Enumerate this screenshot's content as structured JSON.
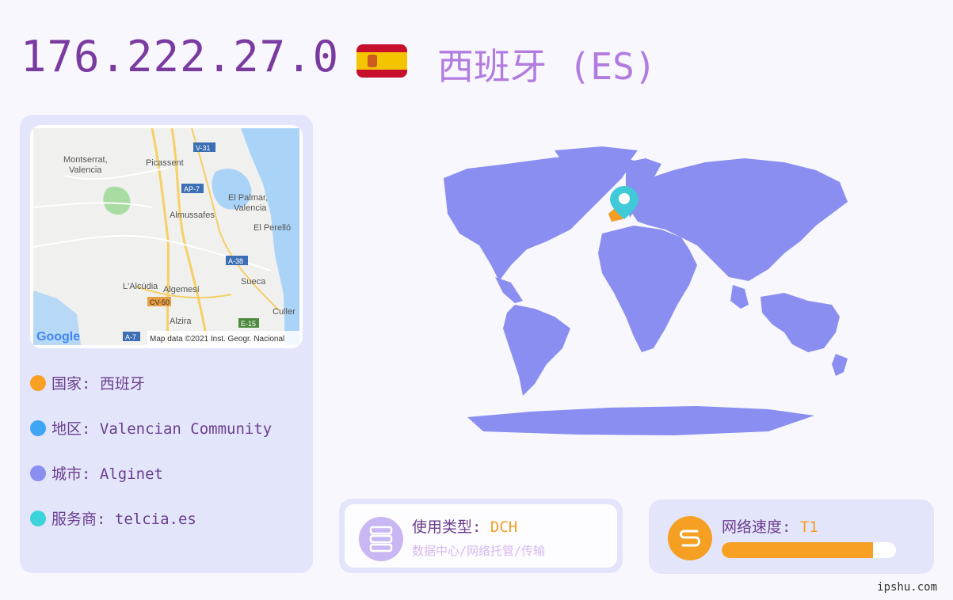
{
  "header": {
    "ip": "176.222.27.0",
    "country_title": "西班牙 (ES)"
  },
  "mini_map": {
    "labels": {
      "montserrat": "Montserrat,",
      "montserrat2": "Valencia",
      "picassent": "Picassent",
      "v31": "V-31",
      "ap7": "AP-7",
      "palmar": "El Palmar,",
      "palmar2": "Valencia",
      "almussafes": "Almussafes",
      "perello": "El Perelló",
      "a38": "A-38",
      "alcudia": "L'Alcúdia",
      "algemesi": "Algemesí",
      "sueca": "Sueca",
      "cv50": "CV-50",
      "alzira": "Alzira",
      "e15": "E-15",
      "cullera": "Culler",
      "a7": "A-7",
      "google": "Google",
      "attribution": "Map data ©2021 Inst. Geogr. Nacional"
    }
  },
  "info": {
    "country": "国家: 西班牙",
    "region": "地区: Valencian Community",
    "city": "城市: Alginet",
    "isp": "服务商: telcia.es"
  },
  "colors": {
    "country_dot": "#f7a023",
    "region_dot": "#3fa5f5",
    "city_dot": "#8a8ef0",
    "isp_dot": "#3dd3dc",
    "world_land": "#8a8ef0",
    "highlight": "#f59d1f",
    "pin": "#40c9d6"
  },
  "usage": {
    "label": "使用类型: ",
    "value": "DCH",
    "sub": "数据中心/网络托管/传输",
    "icon": "server-icon"
  },
  "speed": {
    "label": "网络速度: ",
    "value": "T1",
    "fill_fraction": 0.87,
    "icon": "speed-icon"
  },
  "footer": {
    "site": "ipshu.com"
  }
}
